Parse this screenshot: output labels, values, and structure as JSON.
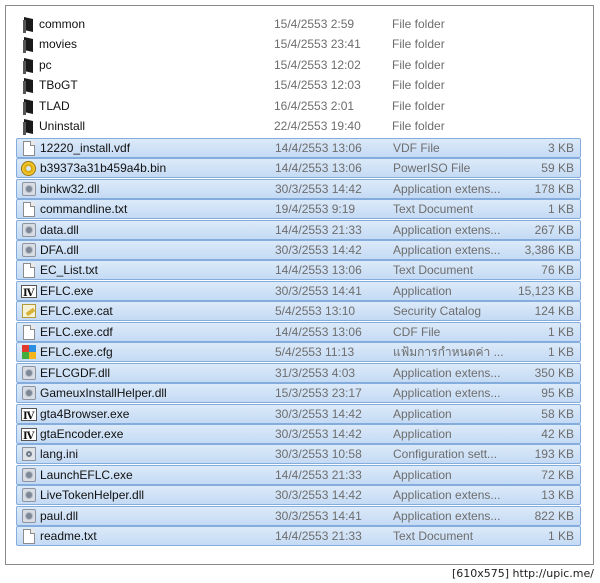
{
  "files": [
    {
      "name": "common",
      "date": "15/4/2553 2:59",
      "type": "File folder",
      "size": "",
      "icon": "folder-icon",
      "selected": false
    },
    {
      "name": "movies",
      "date": "15/4/2553 23:41",
      "type": "File folder",
      "size": "",
      "icon": "folder-icon",
      "selected": false
    },
    {
      "name": "pc",
      "date": "15/4/2553 12:02",
      "type": "File folder",
      "size": "",
      "icon": "folder-icon",
      "selected": false
    },
    {
      "name": "TBoGT",
      "date": "15/4/2553 12:03",
      "type": "File folder",
      "size": "",
      "icon": "folder-icon",
      "selected": false
    },
    {
      "name": "TLAD",
      "date": "16/4/2553 2:01",
      "type": "File folder",
      "size": "",
      "icon": "folder-icon",
      "selected": false
    },
    {
      "name": "Uninstall",
      "date": "22/4/2553 19:40",
      "type": "File folder",
      "size": "",
      "icon": "folder-icon",
      "selected": false
    },
    {
      "name": "12220_install.vdf",
      "date": "14/4/2553 13:06",
      "type": "VDF File",
      "size": "3 KB",
      "icon": "document-icon",
      "selected": true
    },
    {
      "name": "b39373a31b459a4b.bin",
      "date": "14/4/2553 13:06",
      "type": "PowerISO File",
      "size": "59 KB",
      "icon": "disc-image-icon",
      "selected": true
    },
    {
      "name": "binkw32.dll",
      "date": "30/3/2553 14:42",
      "type": "Application extens...",
      "size": "178 KB",
      "icon": "dll-icon",
      "selected": true
    },
    {
      "name": "commandline.txt",
      "date": "19/4/2553 9:19",
      "type": "Text Document",
      "size": "1 KB",
      "icon": "document-icon",
      "selected": true
    },
    {
      "name": "data.dll",
      "date": "14/4/2553 21:33",
      "type": "Application extens...",
      "size": "267 KB",
      "icon": "dll-icon",
      "selected": true
    },
    {
      "name": "DFA.dll",
      "date": "30/3/2553 14:42",
      "type": "Application extens...",
      "size": "3,386 KB",
      "icon": "dll-icon",
      "selected": true
    },
    {
      "name": "EC_List.txt",
      "date": "14/4/2553 13:06",
      "type": "Text Document",
      "size": "76 KB",
      "icon": "document-icon",
      "selected": true
    },
    {
      "name": "EFLC.exe",
      "date": "30/3/2553 14:41",
      "type": "Application",
      "size": "15,123 KB",
      "icon": "gta-exe-icon",
      "selected": true
    },
    {
      "name": "EFLC.exe.cat",
      "date": "5/4/2553 13:10",
      "type": "Security Catalog",
      "size": "124 KB",
      "icon": "security-catalog-icon",
      "selected": true
    },
    {
      "name": "EFLC.exe.cdf",
      "date": "14/4/2553 13:06",
      "type": "CDF File",
      "size": "1 KB",
      "icon": "document-icon",
      "selected": true
    },
    {
      "name": "EFLC.exe.cfg",
      "date": "5/4/2553 11:13",
      "type": "แฟ้มการกำหนดค่า ...",
      "size": "1 KB",
      "icon": "config-file-icon",
      "selected": true
    },
    {
      "name": "EFLCGDF.dll",
      "date": "31/3/2553 4:03",
      "type": "Application extens...",
      "size": "350 KB",
      "icon": "dll-icon",
      "selected": true
    },
    {
      "name": "GameuxInstallHelper.dll",
      "date": "15/3/2553 23:17",
      "type": "Application extens...",
      "size": "95 KB",
      "icon": "dll-icon",
      "selected": true
    },
    {
      "name": "gta4Browser.exe",
      "date": "30/3/2553 14:42",
      "type": "Application",
      "size": "58 KB",
      "icon": "gta-exe-icon",
      "selected": true
    },
    {
      "name": "gtaEncoder.exe",
      "date": "30/3/2553 14:42",
      "type": "Application",
      "size": "42 KB",
      "icon": "gta-exe-icon",
      "selected": true
    },
    {
      "name": "lang.ini",
      "date": "30/3/2553 10:58",
      "type": "Configuration sett...",
      "size": "193 KB",
      "icon": "ini-settings-icon",
      "selected": true
    },
    {
      "name": "LaunchEFLC.exe",
      "date": "14/4/2553 21:33",
      "type": "Application",
      "size": "72 KB",
      "icon": "dll-icon",
      "selected": true
    },
    {
      "name": "LiveTokenHelper.dll",
      "date": "30/3/2553 14:42",
      "type": "Application extens...",
      "size": "13 KB",
      "icon": "dll-icon",
      "selected": true
    },
    {
      "name": "paul.dll",
      "date": "30/3/2553 14:41",
      "type": "Application extens...",
      "size": "822 KB",
      "icon": "dll-icon",
      "selected": true
    },
    {
      "name": "readme.txt",
      "date": "14/4/2553 21:33",
      "type": "Text Document",
      "size": "1 KB",
      "icon": "document-icon",
      "selected": true
    }
  ],
  "footer": {
    "text": "[610x575] http://upic.me/"
  }
}
